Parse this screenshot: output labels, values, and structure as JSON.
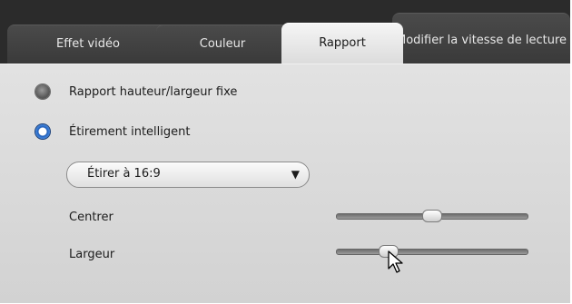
{
  "tabs": [
    {
      "label": "Effet vidéo",
      "active": false
    },
    {
      "label": "Couleur",
      "active": false
    },
    {
      "label": "Rapport",
      "active": true
    },
    {
      "label": "Modifier la vitesse de lecture",
      "active": false
    }
  ],
  "aspect": {
    "option_fixed": {
      "label": "Rapport hauteur/largeur fixe",
      "selected": false
    },
    "option_smart": {
      "label": "Étirement intelligent",
      "selected": true
    },
    "stretch_select": {
      "value": "Étirer à 16:9"
    },
    "center": {
      "label": "Centrer",
      "level": 0.5
    },
    "width": {
      "label": "Largeur",
      "level": 0.27
    }
  },
  "icons": {
    "dropdown": "chevron-down-icon",
    "pointer": "mouse-pointer-icon"
  },
  "colors": {
    "accent": "#2f6fc8",
    "tabbar": "#2b2b2b",
    "panel": "#d8d8d8"
  }
}
